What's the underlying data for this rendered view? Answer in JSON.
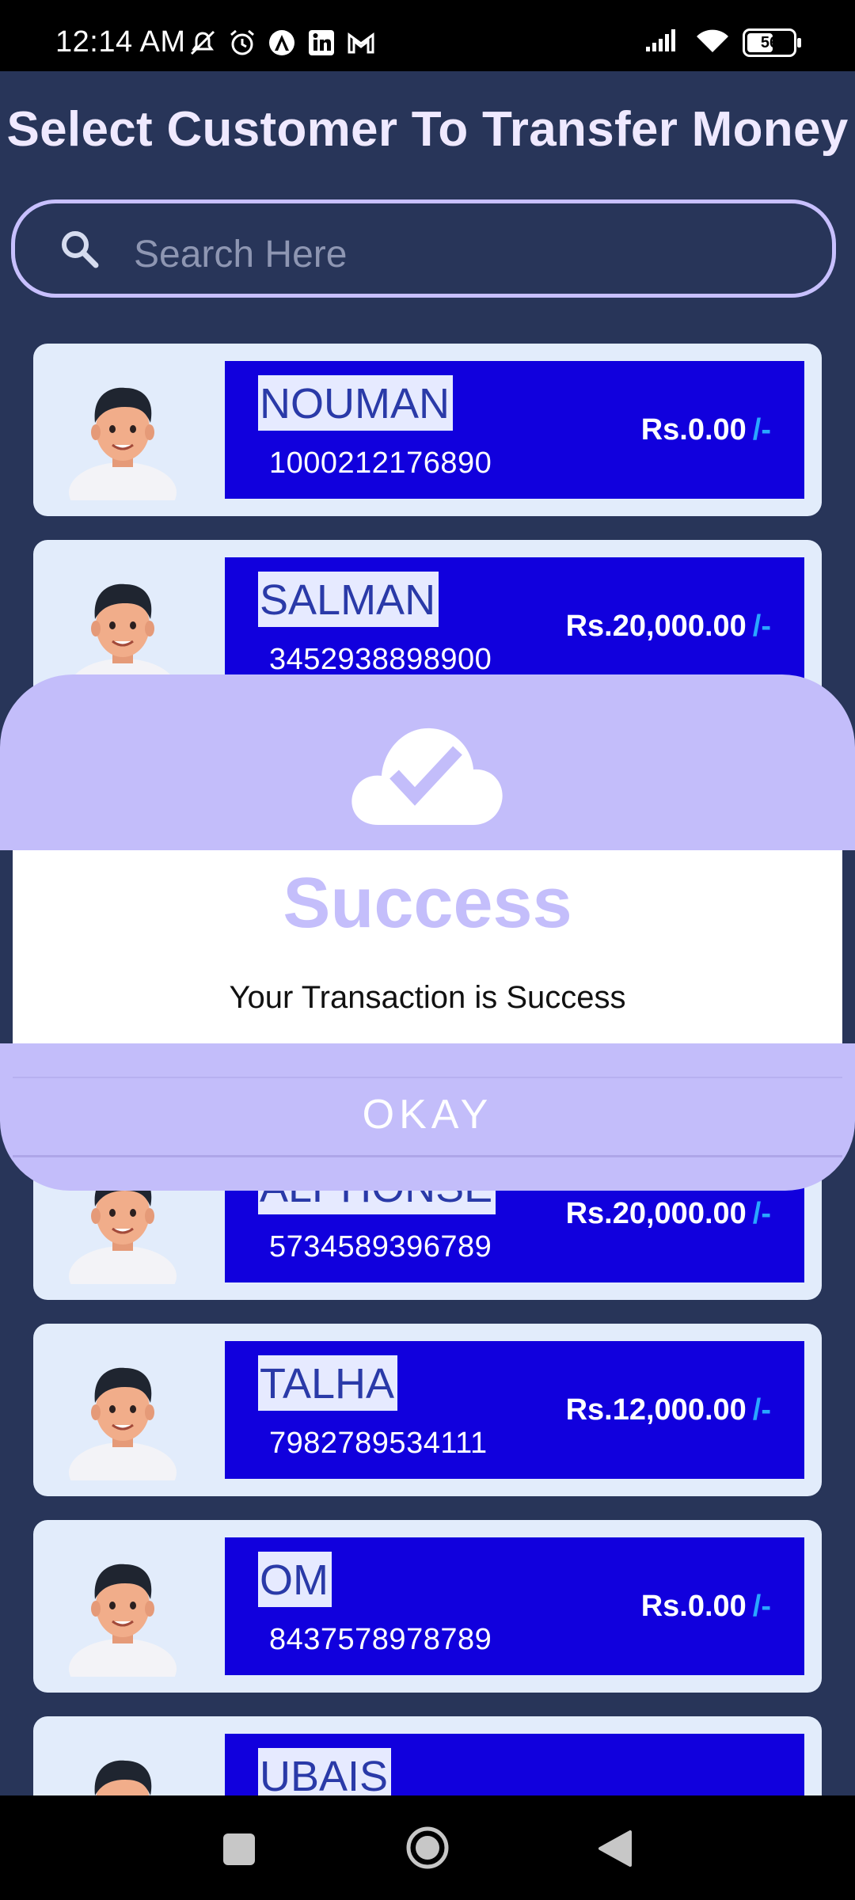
{
  "status_bar": {
    "time": "12:14 AM",
    "battery": "56",
    "left_icons": [
      "mute-icon",
      "alarm-icon",
      "app-icon",
      "linkedin-icon",
      "gmail-icon"
    ],
    "right_icons": [
      "signal-icon",
      "wifi-icon",
      "battery-icon"
    ]
  },
  "header": {
    "title": "Select Customer To Transfer Money"
  },
  "search": {
    "placeholder": "Search Here"
  },
  "customers": [
    {
      "name": "NOUMAN",
      "account": "1000212176890",
      "balance": "Rs.0.00",
      "suffix": "/-"
    },
    {
      "name": "SALMAN",
      "account": "3452938898900",
      "balance": "Rs.20,000.00",
      "suffix": "/-"
    },
    {
      "name": "ALPHONSE",
      "account": "5734589396789",
      "balance": "Rs.20,000.00",
      "suffix": "/-"
    },
    {
      "name": "TALHA",
      "account": "7982789534111",
      "balance": "Rs.12,000.00",
      "suffix": "/-"
    },
    {
      "name": "OM",
      "account": "8437578978789",
      "balance": "Rs.0.00",
      "suffix": "/-"
    },
    {
      "name": "UBAIS",
      "account": "",
      "balance": "",
      "suffix": ""
    }
  ],
  "dialog": {
    "icon": "cloud-check-icon",
    "title": "Success",
    "message": "Your Transaction is Success",
    "button": "OKAY"
  },
  "nav_bar": {
    "icons": [
      "recents-square-icon",
      "home-circle-icon",
      "back-triangle-icon"
    ]
  },
  "colors": {
    "background": "#283559",
    "card": "#e2ecfb",
    "panel": "#1100dd",
    "dialog": "#c3bdfa",
    "suffix": "#29a7ff"
  }
}
